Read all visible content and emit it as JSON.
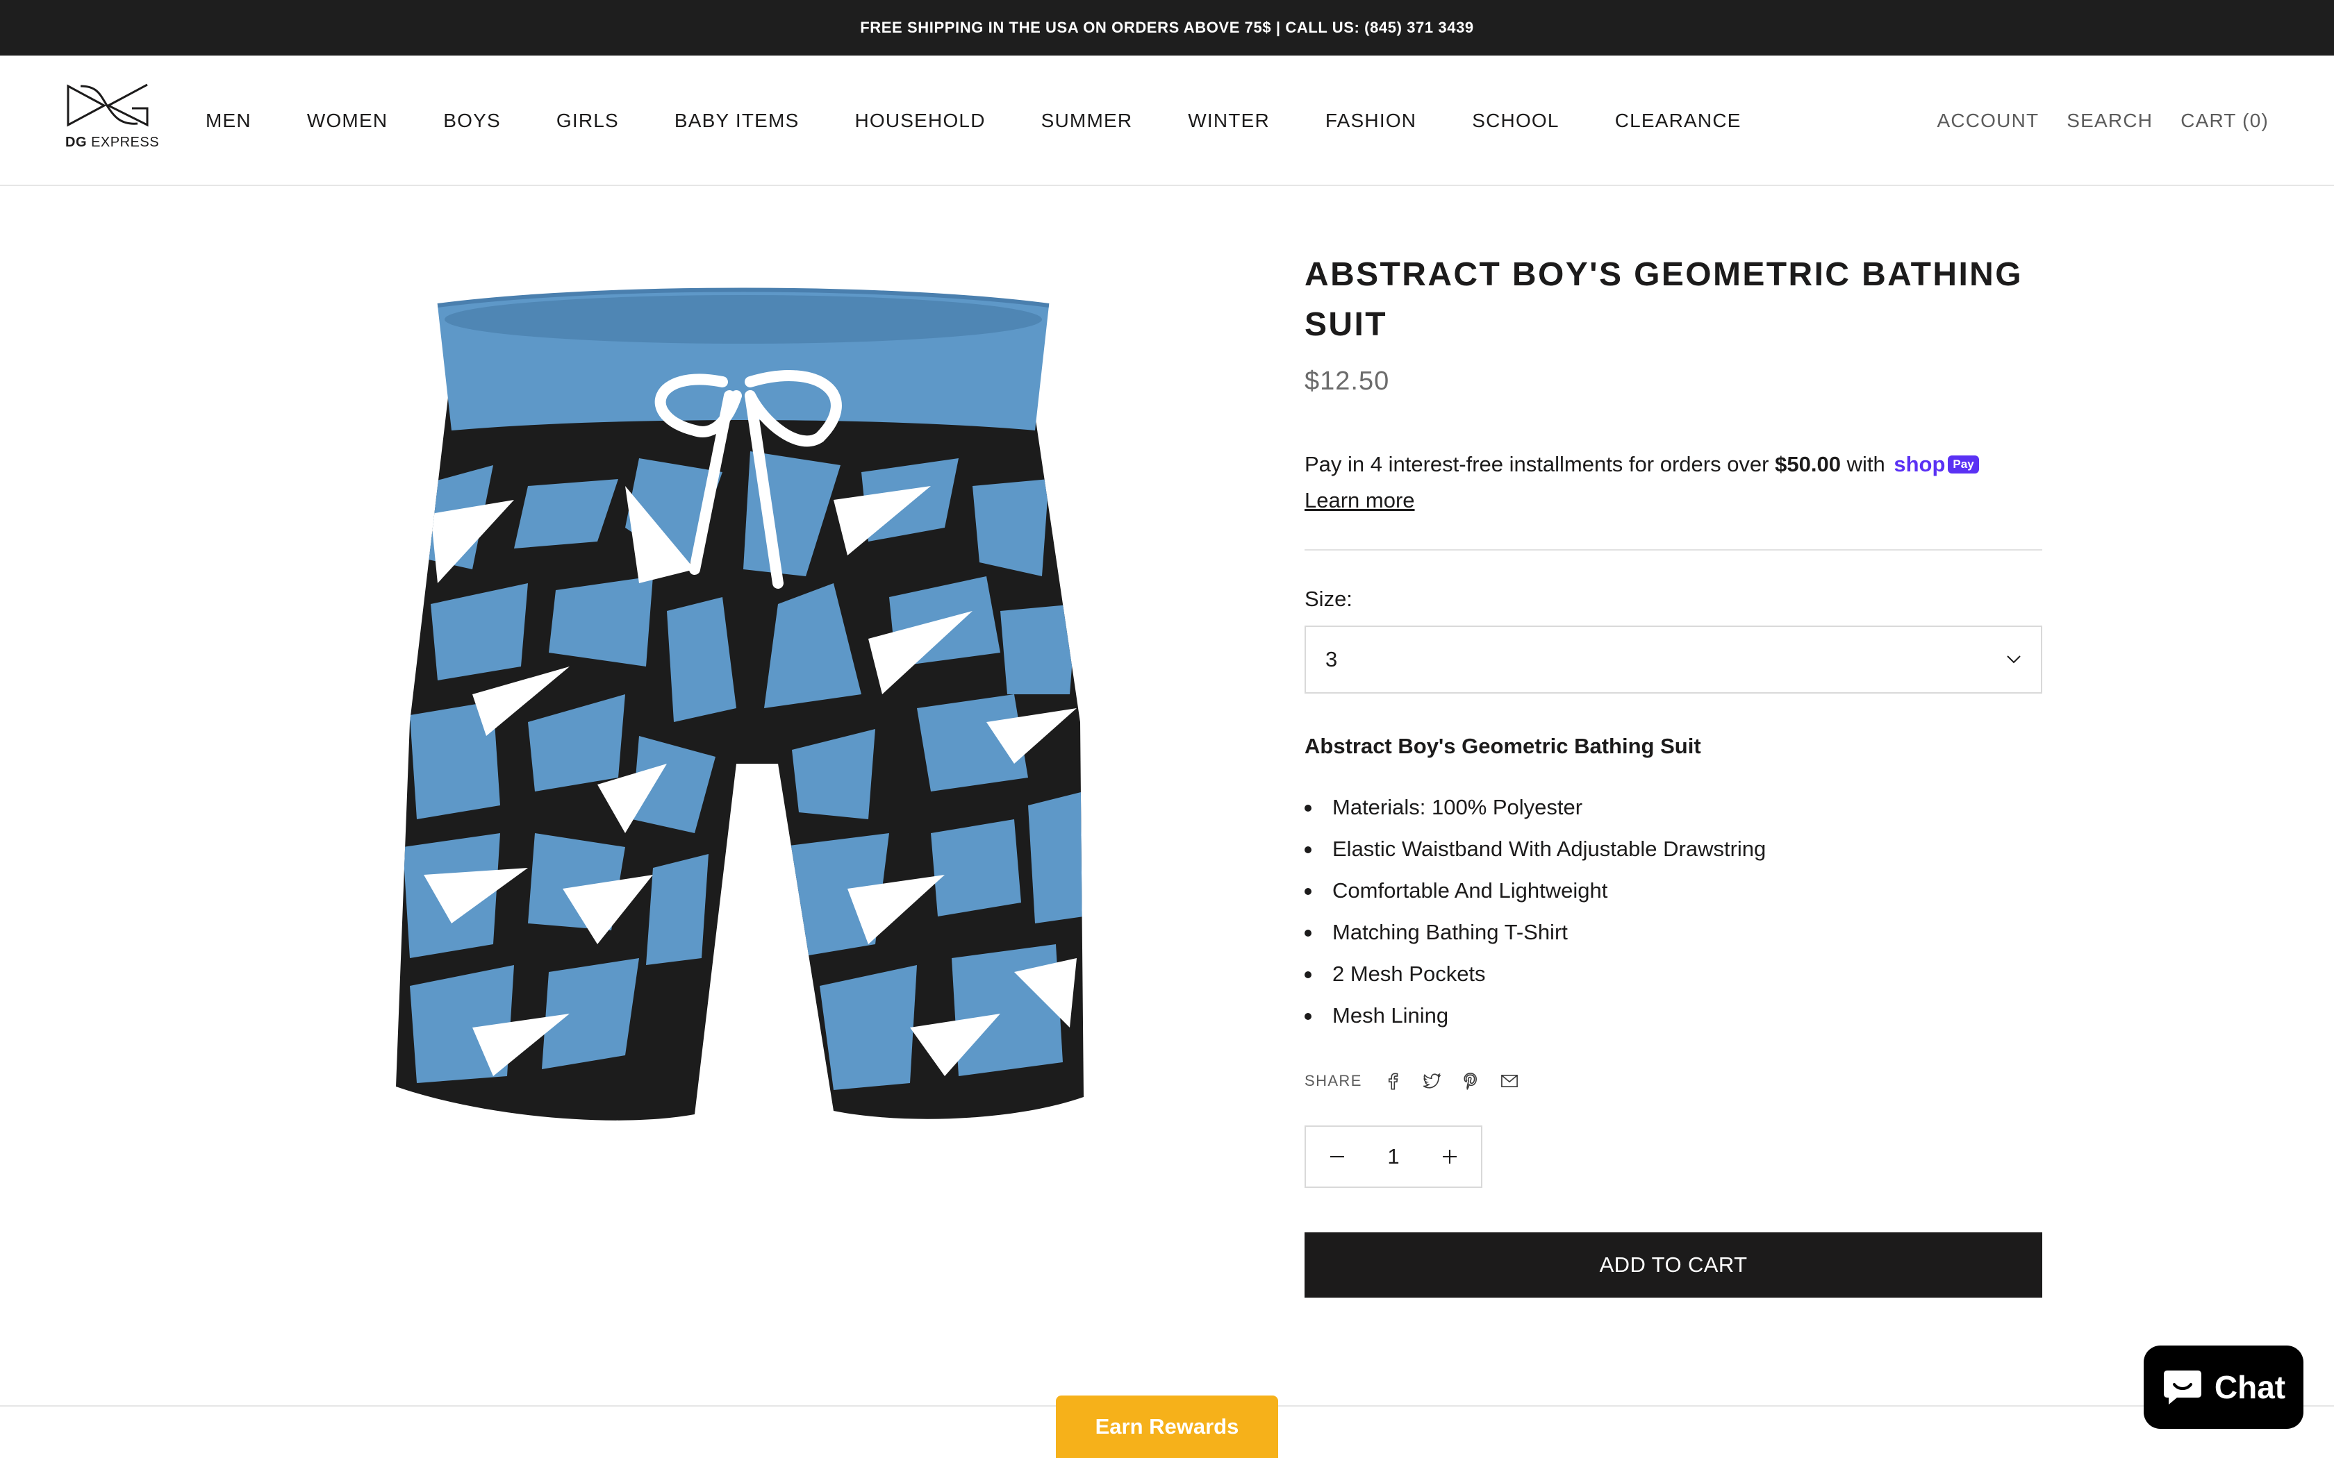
{
  "announcement": {
    "text": "FREE SHIPPING IN THE USA ON ORDERS ABOVE 75$ | CALL US: (845) 371 3439"
  },
  "header": {
    "logo_text_bold": "DG",
    "logo_text_rest": "EXPRESS",
    "nav": [
      "MEN",
      "WOMEN",
      "BOYS",
      "GIRLS",
      "BABY ITEMS",
      "HOUSEHOLD",
      "SUMMER",
      "WINTER",
      "FASHION",
      "SCHOOL",
      "CLEARANCE"
    ],
    "account": "ACCOUNT",
    "search": "SEARCH",
    "cart": "CART (0)"
  },
  "product": {
    "title": "ABSTRACT BOY'S GEOMETRIC BATHING SUIT",
    "price": "$12.50",
    "installments": {
      "prefix": "Pay in 4 interest-free installments for orders over",
      "amount": "$50.00",
      "suffix": "with",
      "shop": "shop",
      "pay": "Pay",
      "learn_more": "Learn more"
    },
    "size_label": "Size:",
    "size_value": "3",
    "description_title": "Abstract Boy's Geometric Bathing Suit",
    "bullets": [
      "Materials: 100% Polyester",
      "Elastic Waistband With Adjustable Drawstring",
      "Comfortable And Lightweight",
      "Matching Bathing T-Shirt",
      "2 Mesh Pockets",
      "Mesh Lining"
    ],
    "share_label": "SHARE",
    "share_icons": [
      "facebook-icon",
      "twitter-icon",
      "pinterest-icon",
      "email-icon"
    ],
    "quantity": "1",
    "add_to_cart": "ADD TO CART",
    "colors": {
      "blue": "#5e98c8",
      "dark": "#1c1b1b"
    }
  },
  "widgets": {
    "rewards": "Earn Rewards",
    "chat": "Chat",
    "rewards_color": "#f6b11a"
  }
}
